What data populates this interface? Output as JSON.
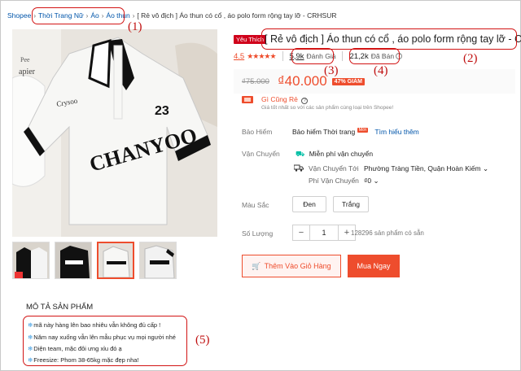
{
  "breadcrumb": {
    "items": [
      "Shopee",
      "Thời Trang Nữ",
      "Áo",
      "Áo thun"
    ],
    "current": "[ Rẻ vô địch ] Áo thun có cổ , áo polo form rộng tay lỡ - CRHSUR"
  },
  "annotations": [
    "(1)",
    "(2)",
    "(3)",
    "(4)",
    "(5)"
  ],
  "product": {
    "tag": "Yêu Thích",
    "title": "[ Rẻ vô địch ] Áo thun có cổ , áo polo form rộng tay lỡ - CRHS",
    "rating": "4.5",
    "stars": "★★★★★",
    "reviews_count": "5,9k",
    "reviews_label": "Đánh Giá",
    "sold_count": "21,2k",
    "sold_label": "Đã Bán",
    "old_price": "₫75.000",
    "new_price": "₫40.000",
    "discount": "47% GIẢM",
    "shirt_text": "CHANYOO",
    "shirt_number": "23"
  },
  "guarantee": {
    "title": "Gì Cũng Rẻ",
    "subtitle": "Giá tốt nhất so với các sản phẩm cùng loại trên Shopee!"
  },
  "insurance": {
    "label": "Bảo Hiểm",
    "value": "Bảo hiểm Thời trang",
    "badge": "Mới",
    "link": "Tìm hiểu thêm"
  },
  "shipping": {
    "label": "Vận Chuyển",
    "free": "Miễn phí vận chuyển",
    "to_label": "Vận Chuyển Tới",
    "to_value": "Phường Tràng Tiền, Quận Hoàn Kiếm",
    "fee_label": "Phí Vận Chuyển",
    "fee_value": "₫0"
  },
  "color": {
    "label": "Màu Sắc",
    "options": [
      "Đen",
      "Trắng"
    ]
  },
  "quantity": {
    "label": "Số Lượng",
    "value": "1",
    "stock": "128296 sản phẩm có sẵn",
    "minus": "−",
    "plus": "+"
  },
  "buttons": {
    "add_cart": "Thêm Vào Giỏ Hàng",
    "buy": "Mua Ngay"
  },
  "description": {
    "title": "MÔ TẢ SẢN PHẨM",
    "lines": [
      "mã này hàng lên bao nhiêu vẫn không đủ cấp !",
      "Năm nay xuống vẫn lên mẫu phục vụ mọi người nhé",
      "Diện team, mặc đôi ưng xỉu đó ạ",
      "Freesize: Phom 38-65kg mặc đẹp nha!"
    ]
  },
  "colors": {
    "accent": "#ee4d2d",
    "annotation": "#d21414",
    "link": "#0055aa"
  }
}
